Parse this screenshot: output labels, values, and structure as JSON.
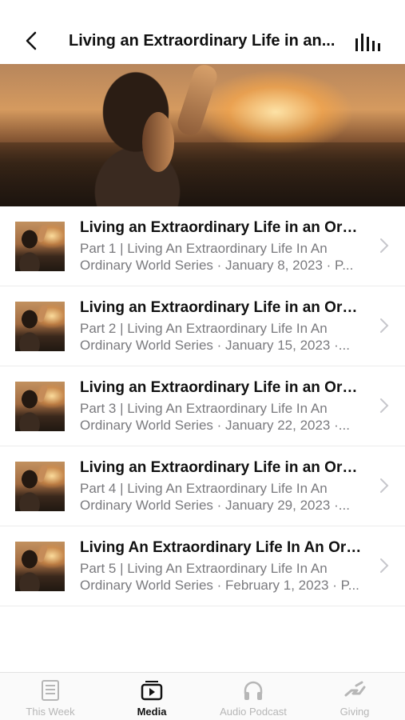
{
  "header": {
    "title": "Living an Extraordinary Life in an...",
    "back_icon": "chevron-left-icon",
    "audio_icon": "equalizer-icon"
  },
  "hero": {
    "image": "woman-sunset-image"
  },
  "items": [
    {
      "title": "Living an Extraordinary Life in an Ordi...",
      "subtitle": "Part 1 | Living An Extraordinary Life In An Ordinary World Series · January 8, 2023 · P..."
    },
    {
      "title": "Living an Extraordinary Life in an Ordi...",
      "subtitle": "Part 2 | Living An Extraordinary Life In An Ordinary World Series · January 15, 2023 ·..."
    },
    {
      "title": "Living an Extraordinary Life in an Ordi...",
      "subtitle": "Part 3 | Living An Extraordinary Life In An Ordinary World Series · January 22, 2023 ·..."
    },
    {
      "title": "Living an Extraordinary Life in an Ordi...",
      "subtitle": "Part 4 | Living An Extraordinary Life In An Ordinary World Series · January 29, 2023 ·..."
    },
    {
      "title": "Living An Extraordinary Life In An Ord...",
      "subtitle": "Part 5 | Living An Extraordinary Life In An Ordinary World Series · February 1, 2023 · P..."
    }
  ],
  "tabs": [
    {
      "label": "This Week",
      "icon": "news-icon",
      "active": false
    },
    {
      "label": "Media",
      "icon": "media-play-icon",
      "active": true
    },
    {
      "label": "Audio Podcast",
      "icon": "headphones-icon",
      "active": false
    },
    {
      "label": "Giving",
      "icon": "giving-hand-icon",
      "active": false
    }
  ],
  "colors": {
    "accent": "#111111",
    "inactive": "#b6b6b6",
    "subtitle": "#7a7a7e"
  }
}
